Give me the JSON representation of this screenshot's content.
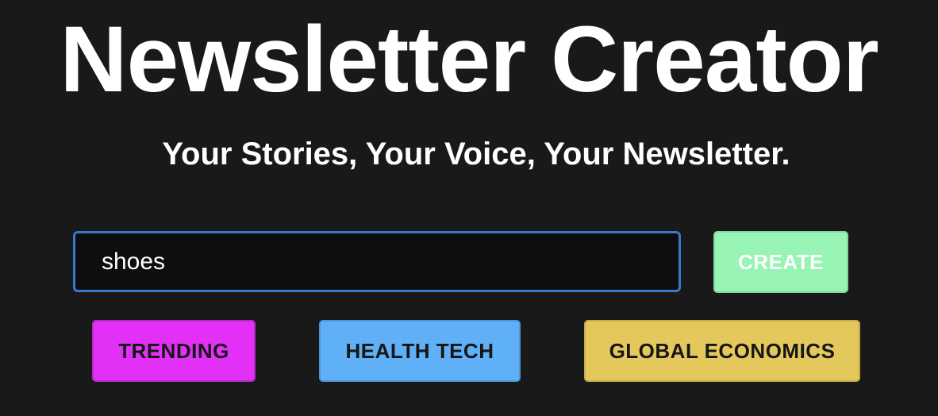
{
  "header": {
    "title": "Newsletter Creator",
    "subtitle": "Your Stories, Your Voice, Your Newsletter."
  },
  "form": {
    "topic_value": "shoes",
    "create_label": "CREATE"
  },
  "tags": [
    {
      "label": "TRENDING",
      "color": "#e230f6"
    },
    {
      "label": "HEALTH TECH",
      "color": "#5fb0f7"
    },
    {
      "label": "GLOBAL ECONOMICS",
      "color": "#e5c85b"
    }
  ],
  "colors": {
    "background": "#1a191a",
    "input_border": "#3a78c9",
    "create_button": "#98f4b4"
  }
}
